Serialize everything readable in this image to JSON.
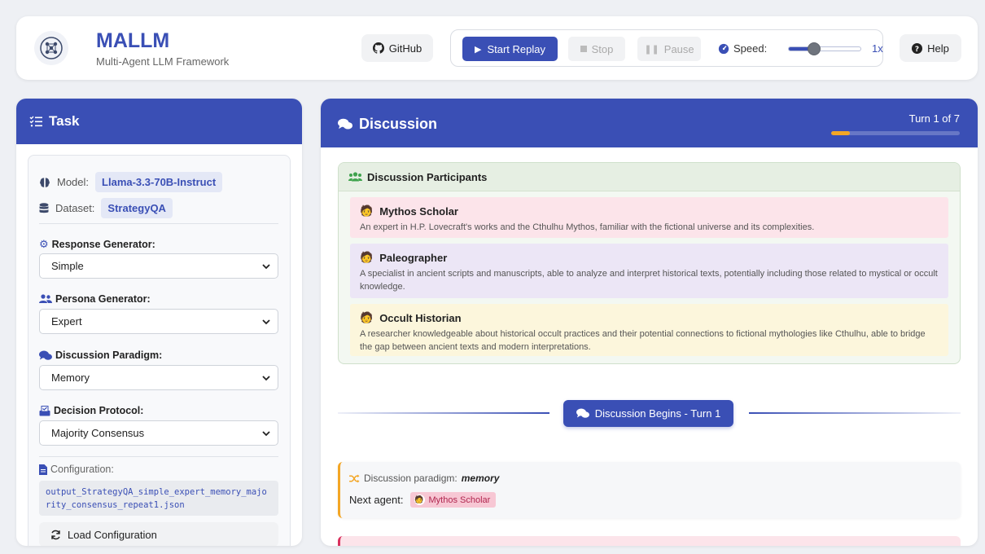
{
  "header": {
    "title": "MALLM",
    "subtitle": "Multi-Agent LLM Framework",
    "github_label": "GitHub",
    "start_label": "Start Replay",
    "stop_label": "Stop",
    "pause_label": "Pause",
    "speed_label": "Speed:",
    "speed_value": "1x",
    "speed_slider_level": 0.35,
    "help_label": "Help"
  },
  "task": {
    "title": "Task",
    "model_label": "Model:",
    "model_value": "Llama-3.3-70B-Instruct",
    "dataset_label": "Dataset:",
    "dataset_value": "StrategyQA",
    "response_generator_label": "Response Generator:",
    "response_generator_value": "Simple",
    "persona_generator_label": "Persona Generator:",
    "persona_generator_value": "Expert",
    "discussion_paradigm_label": "Discussion Paradigm:",
    "discussion_paradigm_value": "Memory",
    "decision_protocol_label": "Decision Protocol:",
    "decision_protocol_value": "Majority Consensus",
    "configuration_label": "Configuration:",
    "configuration_file": "output_StrategyQA_simple_expert_memory_majority_consensus_repeat1.json",
    "load_label": "Load Configuration"
  },
  "discussion": {
    "title": "Discussion",
    "turn_text": "Turn 1 of 7",
    "turn_progress": 0.143,
    "participants_title": "Discussion Participants",
    "participants": [
      {
        "name": "Mythos Scholar",
        "description": "An expert in H.P. Lovecraft's works and the Cthulhu Mythos, familiar with the fictional universe and its complexities.",
        "color": "#fce4ea"
      },
      {
        "name": "Paleographer",
        "description": "A specialist in ancient scripts and manuscripts, able to analyze and interpret historical texts, potentially including those related to mystical or occult knowledge.",
        "color": "#ece6f6"
      },
      {
        "name": "Occult Historian",
        "description": "A researcher knowledgeable about historical occult practices and their potential connections to fictional mythologies like Cthulhu, able to bridge the gap between ancient texts and modern interpretations.",
        "color": "#fcf6dc"
      }
    ],
    "begins_label": "Discussion Begins - Turn 1",
    "paradigm_label": "Discussion paradigm:",
    "paradigm_value": "memory",
    "next_agent_label": "Next agent:",
    "next_agent_value": "Mythos Scholar"
  },
  "colors": {
    "primary": "#3a4fb5",
    "accent_orange": "#f3a625",
    "mythos_pink": "#fce4ea",
    "paleographer_purple": "#ece6f6",
    "historian_yellow": "#fcf6dc"
  }
}
